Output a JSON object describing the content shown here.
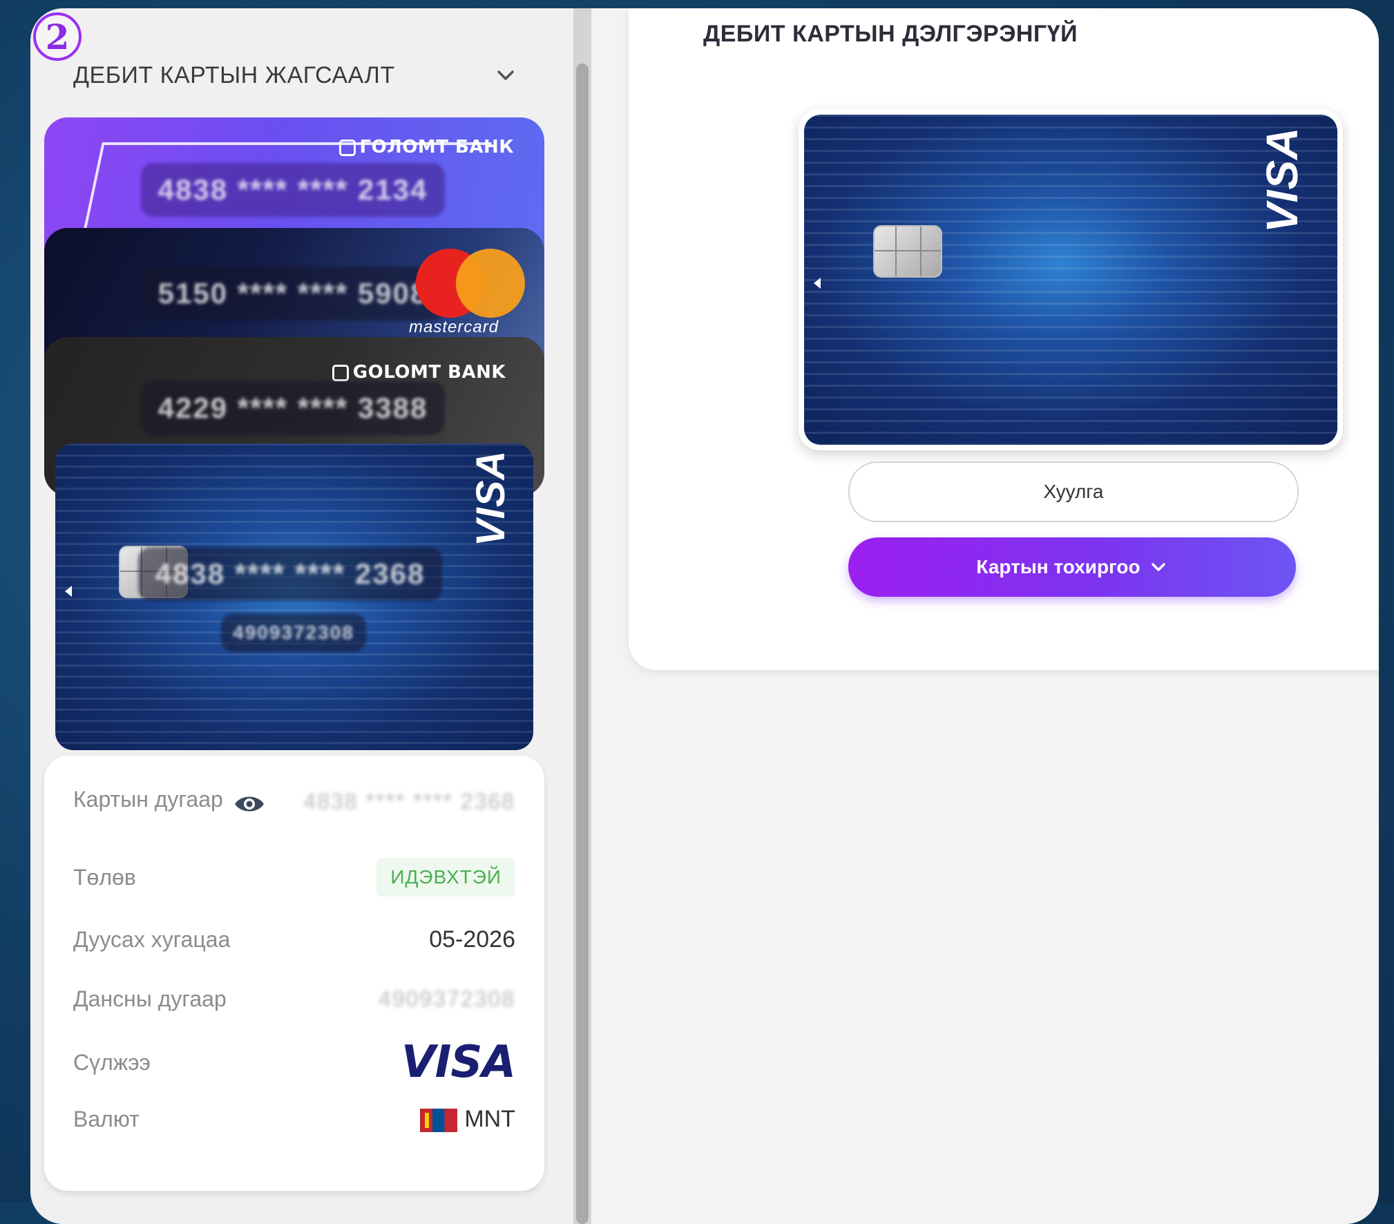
{
  "step_badge": "2",
  "card_list": {
    "title": "ДЕБИТ КАРТЫН ЖАГСААЛТ",
    "cards": [
      {
        "bank": "ГОЛОМТ БАНК",
        "masked_number": "4838 **** **** 2134"
      },
      {
        "network": "mastercard",
        "masked_number": "5150 **** **** 5908"
      },
      {
        "bank": "GOLOMT BANK",
        "masked_number": "4229 **** **** 3388"
      },
      {
        "network": "VISA",
        "masked_number": "4838 **** **** 2368",
        "account": "4909372308"
      }
    ]
  },
  "details": {
    "card_number_label": "Картын дугаар",
    "card_number_value": "4838 **** **** 2368",
    "status_label": "Төлөв",
    "status_value": "ИДЭВХТЭЙ",
    "expiry_label": "Дуусах хугацаа",
    "expiry_value": "05-2026",
    "account_label": "Дансны дугаар",
    "account_value": "4909372308",
    "network_label": "Сүлжээ",
    "network_value": "VISA",
    "currency_label": "Валют",
    "currency_value": "MNT"
  },
  "detail_panel": {
    "title": "ДЕБИТ КАРТЫН ДЭЛГЭРЭНГҮЙ",
    "card_network": "VISA",
    "instructions_button": "Хуулга",
    "settings_button": "Картын тохиргоо"
  },
  "colors": {
    "accent": "#8a2be2",
    "status_green": "#4caf50",
    "visa_blue": "#1a1f71"
  }
}
